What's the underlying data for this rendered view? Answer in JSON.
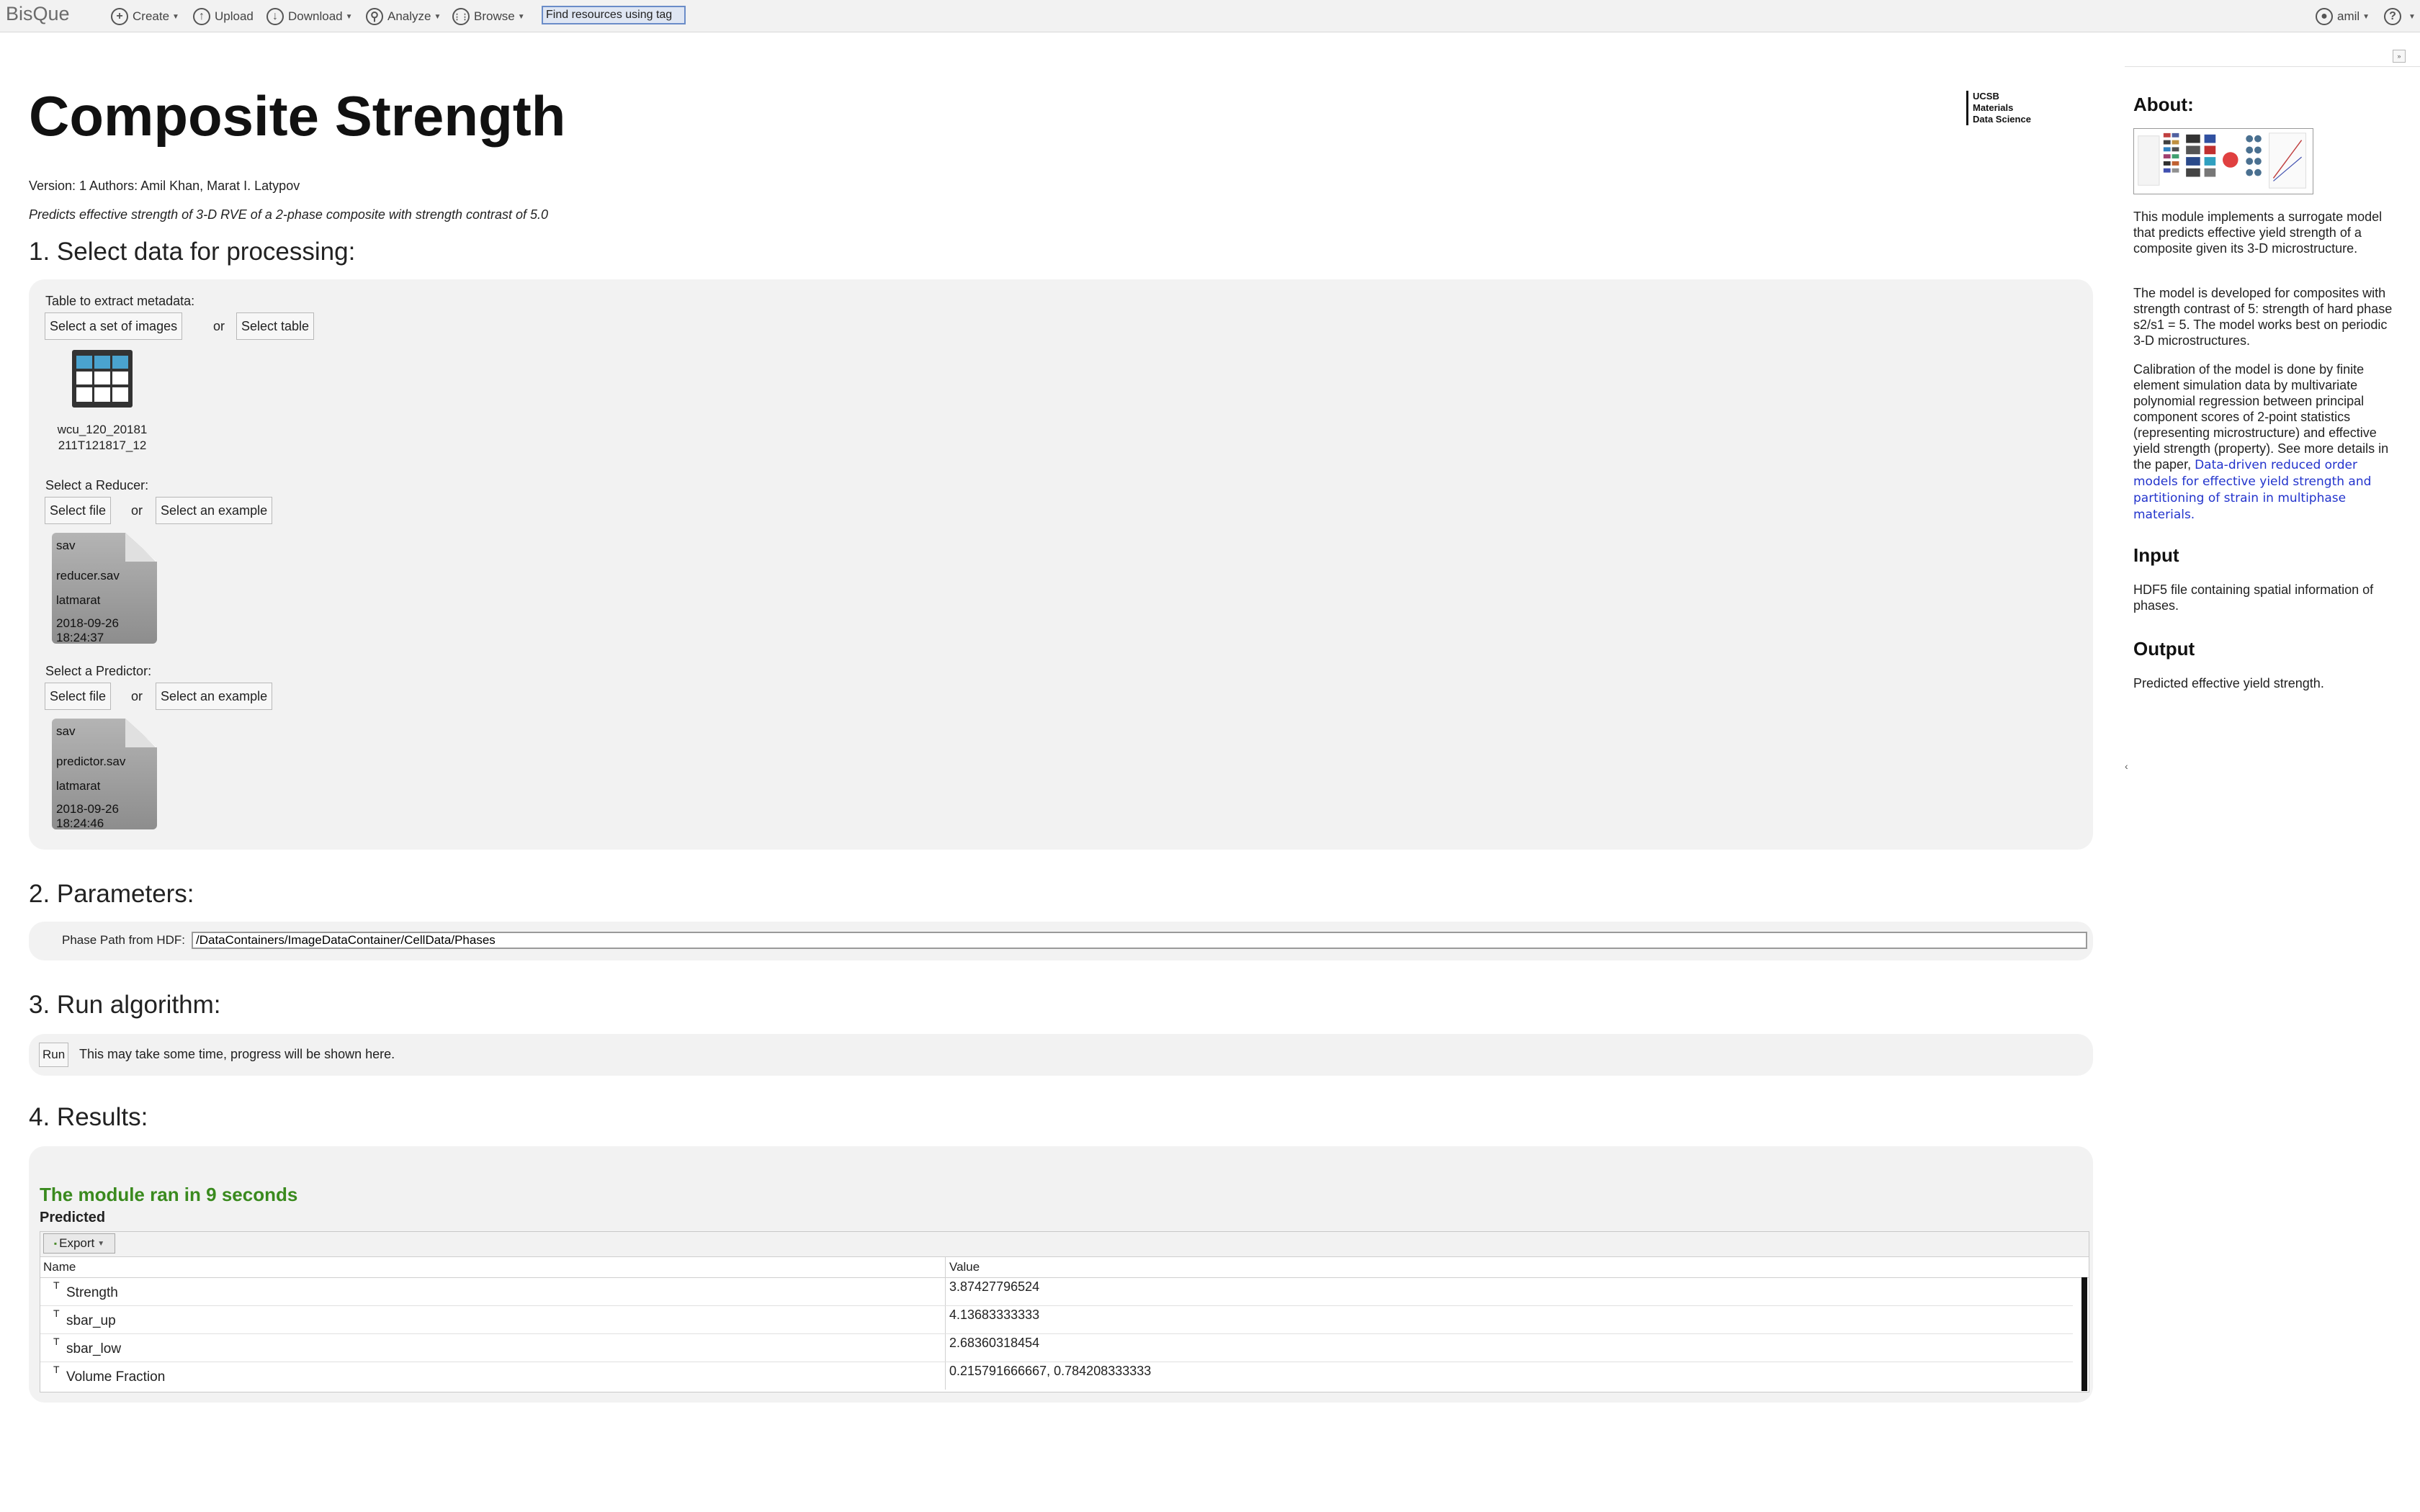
{
  "toolbar": {
    "brand": "BisQue",
    "create": "Create",
    "upload": "Upload",
    "download": "Download",
    "analyze": "Analyze",
    "browse": "Browse",
    "search_value": "Find resources using tag",
    "user": "amil",
    "help": "?"
  },
  "header": {
    "title": "Composite Strength",
    "logo_lines": [
      "UCSB",
      "Materials",
      "Data Science"
    ],
    "version_line": "Version: 1 Authors: Amil Khan, Marat I. Latypov",
    "description": "Predicts effective strength of 3-D RVE of a 2-phase composite with strength contrast of 5.0"
  },
  "section1": {
    "title": "1. Select data for processing:",
    "table_label": "Table to extract metadata:",
    "select_images": "Select a set of images",
    "or": "or",
    "select_table": "Select table",
    "table_name_l1": "wcu_120_20181",
    "table_name_l2": "211T121817_12",
    "reducer_label": "Select a Reducer:",
    "select_file": "Select file",
    "select_example": "Select an example",
    "reducer_card": {
      "ext": "sav",
      "name": "reducer.sav",
      "owner": "latmarat",
      "date": "2018-09-26",
      "time": "18:24:37"
    },
    "predictor_label": "Select a Predictor:",
    "predictor_card": {
      "ext": "sav",
      "name": "predictor.sav",
      "owner": "latmarat",
      "date": "2018-09-26",
      "time": "18:24:46"
    }
  },
  "section2": {
    "title": "2. Parameters:",
    "phase_label": "Phase Path from HDF:",
    "phase_value": "/DataContainers/ImageDataContainer/CellData/Phases"
  },
  "section3": {
    "title": "3. Run algorithm:",
    "run": "Run",
    "note": "This may take some time, progress will be shown here."
  },
  "section4": {
    "title": "4. Results:",
    "message": "The module ran in 9 seconds",
    "table_title": "Predicted",
    "export": "Export",
    "col_name": "Name",
    "col_value": "Value",
    "type_marker": "T",
    "rows": [
      {
        "name": "Strength",
        "value": "3.87427796524"
      },
      {
        "name": "sbar_up",
        "value": "4.13683333333"
      },
      {
        "name": "sbar_low",
        "value": "2.68360318454"
      },
      {
        "name": "Volume Fraction",
        "value": "0.215791666667, 0.784208333333"
      }
    ]
  },
  "sidebar": {
    "about_h": "About:",
    "about_p1": "This module implements a surrogate model that predicts effective yield strength of a composite given its 3-D microstructure.",
    "about_p2": "The model is developed for composites with strength contrast of 5: strength of hard phase s2/s1 = 5. The model works best on periodic 3-D microstructures.",
    "about_p3": "Calibration of the model is done by finite element simulation data by multivariate polynomial regression between principal component scores of 2-point statistics (representing microstructure) and effective yield strength (property). See more details in the paper,",
    "about_link": "Data-driven reduced order models for effective yield strength and partitioning of strain in multiphase materials.",
    "input_h": "Input",
    "input_p": "HDF5 file containing spatial information of phases.",
    "output_h": "Output",
    "output_p": "Predicted effective yield strength."
  }
}
